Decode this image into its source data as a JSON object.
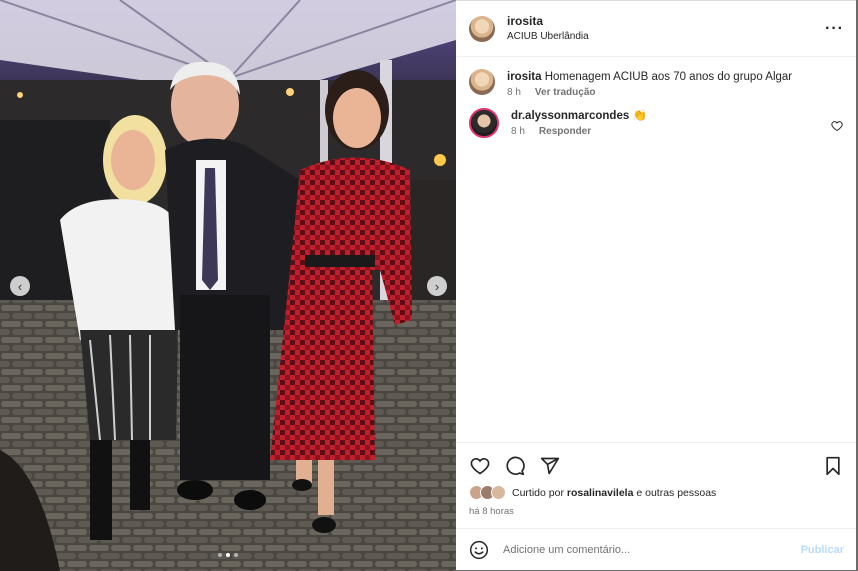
{
  "post": {
    "username": "irosita",
    "location": "ACIUB Uberlândia",
    "more_icon": "more-horizontal-icon"
  },
  "caption": {
    "username": "irosita",
    "text": "Homenagem ACIUB aos 70 anos do grupo Algar",
    "age": "8 h",
    "translate_label": "Ver tradução"
  },
  "comments": [
    {
      "username": "dr.alyssonmarcondes",
      "text": "👏",
      "age": "8 h",
      "reply_label": "Responder"
    }
  ],
  "likes": {
    "prefix": "Curtido por",
    "user": "rosalinavilela",
    "suffix": "e outras pessoas"
  },
  "posted_ago": "há 8 horas",
  "compose": {
    "placeholder": "Adicione um comentário...",
    "publish_label": "Publicar"
  },
  "carousel": {
    "prev_icon": "chevron-left-icon",
    "next_icon": "chevron-right-icon",
    "slide_count": 3,
    "active_index": 1
  },
  "colors": {
    "publish_disabled": "#b8dcfb",
    "story_ring": "#e1306c"
  }
}
